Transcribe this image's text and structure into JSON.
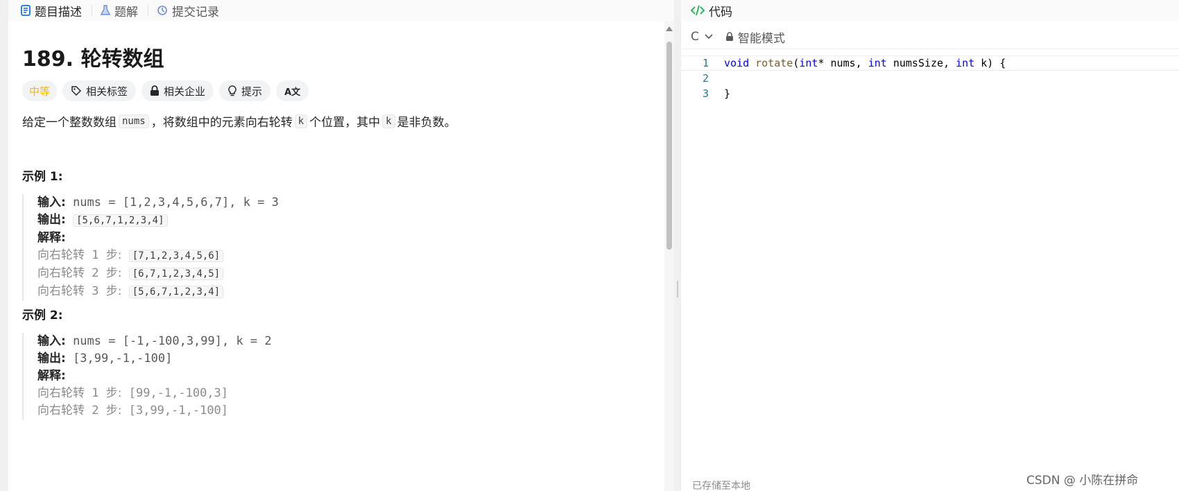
{
  "left_tabs": [
    {
      "label": "题目描述",
      "icon": "doc-icon"
    },
    {
      "label": "题解",
      "icon": "flask-icon"
    },
    {
      "label": "提交记录",
      "icon": "history-icon"
    }
  ],
  "problem": {
    "title": "189. 轮转数组",
    "tags": {
      "difficulty": "中等",
      "related_tags": "相关标签",
      "related_companies": "相关企业",
      "hint": "提示",
      "translate": "A文"
    },
    "description": {
      "p1": "给定一个整数数组",
      "c1": "nums",
      "p2": "，将数组中的元素向右轮转",
      "c2": "k",
      "p3": "个位置，其中",
      "c3": "k",
      "p4": "是非负数。"
    },
    "example1": {
      "title": "示例 1:",
      "input_label": "输入:",
      "input_value": "nums = [1,2,3,4,5,6,7], k = 3",
      "output_label": "输出:",
      "output_value": "[5,6,7,1,2,3,4]",
      "explain_label": "解释:",
      "steps": [
        {
          "prefix": "向右轮转",
          "num": "1",
          "suffix": "步:",
          "value": "[7,1,2,3,4,5,6]"
        },
        {
          "prefix": "向右轮转",
          "num": "2",
          "suffix": "步:",
          "value": "[6,7,1,2,3,4,5]"
        },
        {
          "prefix": "向右轮转",
          "num": "3",
          "suffix": "步:",
          "value": "[5,6,7,1,2,3,4]"
        }
      ]
    },
    "example2": {
      "title": "示例 2:",
      "input_label": "输入:",
      "input_value": "nums = [-1,-100,3,99], k = 2",
      "output_label": "输出:",
      "output_value": "[3,99,-1,-100]",
      "explain_label": "解释:",
      "steps": [
        {
          "prefix": "向右轮转",
          "num": "1",
          "suffix": "步:",
          "value": "[99,-1,-100,3]"
        },
        {
          "prefix": "向右轮转",
          "num": "2",
          "suffix": "步:",
          "value": "[3,99,-1,-100]"
        }
      ]
    }
  },
  "right_panel": {
    "tab_label": "代码",
    "language": "C",
    "mode_label": "智能模式",
    "saved_text": "已存储至本地",
    "code_lines": [
      {
        "num": "1"
      },
      {
        "num": "2"
      },
      {
        "num": "3"
      }
    ],
    "code": {
      "kw_void": "void",
      "fn_name": "rotate",
      "open_paren": "(",
      "kw_int1": "int",
      "arg1": "* nums, ",
      "kw_int2": "int",
      "arg2": " numsSize, ",
      "kw_int3": "int",
      "arg3": " k) {",
      "close": "}"
    }
  },
  "watermark": "CSDN @ 小陈在拼命",
  "colors": {
    "difficulty": "#ffb800",
    "keyword": "#0000ff",
    "function": "#795e26",
    "line_number": "#237893",
    "accent_green": "#2db55d"
  }
}
